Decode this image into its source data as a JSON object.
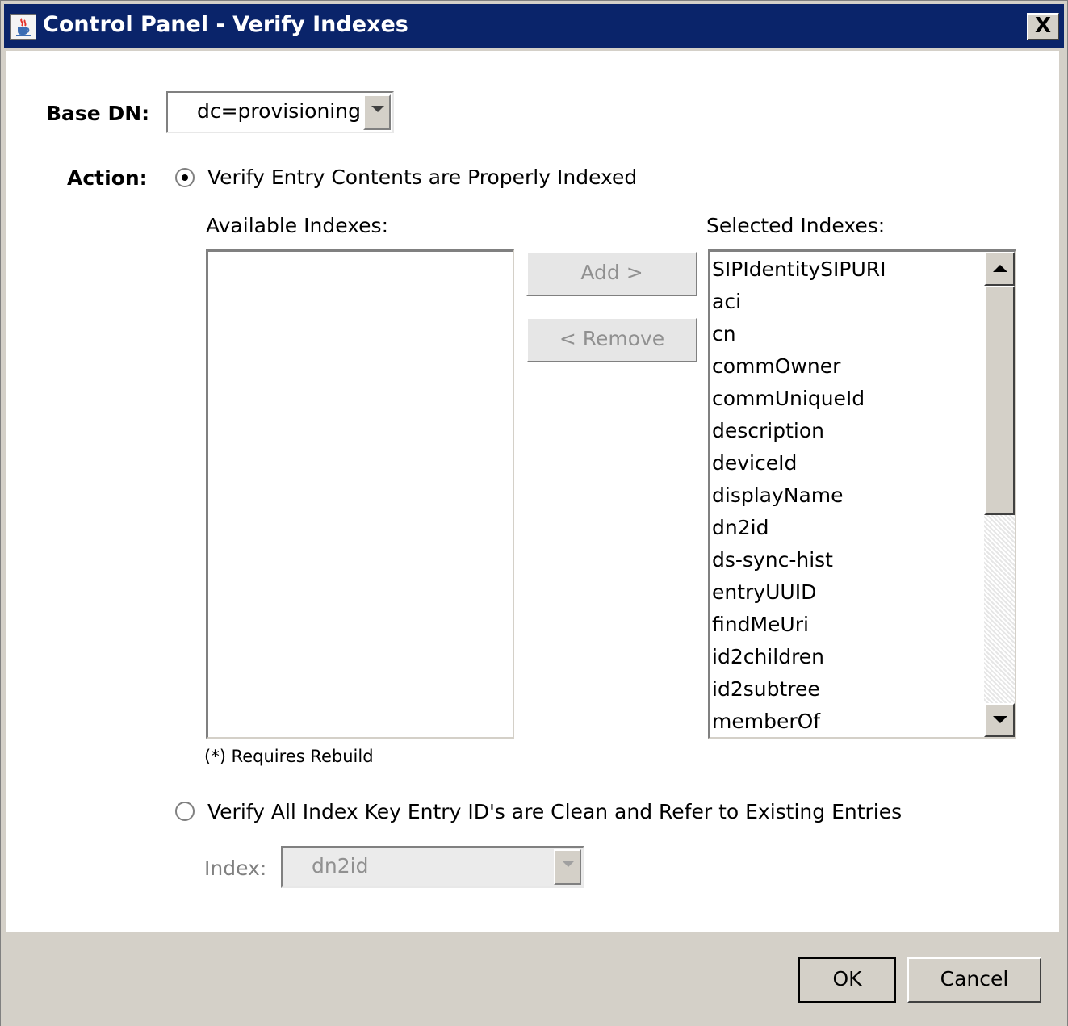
{
  "window": {
    "title": "Control Panel - Verify Indexes",
    "close_label": "X"
  },
  "base_dn": {
    "label": "Base DN:",
    "value": "dc=provisioning"
  },
  "action": {
    "label": "Action:",
    "option1_label": "Verify Entry Contents are Properly Indexed",
    "option1_selected": true,
    "available_label": "Available Indexes:",
    "selected_label": "Selected Indexes:",
    "add_label": "Add >",
    "remove_label": "< Remove",
    "requires_rebuild": "(*) Requires Rebuild",
    "selected_indexes": [
      "SIPIdentitySIPURI",
      "aci",
      "cn",
      "commOwner",
      "commUniqueId",
      "description",
      "deviceId",
      "displayName",
      "dn2id",
      "ds-sync-hist",
      "entryUUID",
      "findMeUri",
      "id2children",
      "id2subtree",
      "memberOf"
    ],
    "option2_label": "Verify All Index Key Entry ID's are Clean and Refer to Existing Entries",
    "option2_selected": false,
    "index_label": "Index:",
    "index_value": "dn2id"
  },
  "footer": {
    "ok_label": "OK",
    "cancel_label": "Cancel"
  },
  "icons": {
    "app": "java-cup-icon",
    "close": "close-icon"
  }
}
